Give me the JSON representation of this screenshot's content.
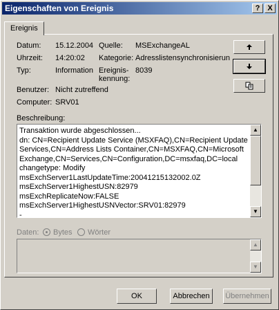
{
  "window": {
    "title": "Eigenschaften von Ereignis",
    "help_btn": "?",
    "close_btn": "X"
  },
  "tab": {
    "label": "Ereignis"
  },
  "fields": {
    "datum_label": "Datum:",
    "datum_value": "15.12.2004",
    "uhrzeit_label": "Uhrzeit:",
    "uhrzeit_value": "14:20:02",
    "typ_label": "Typ:",
    "typ_value": "Information",
    "quelle_label": "Quelle:",
    "quelle_value": "MSExchangeAL",
    "kategorie_label": "Kategorie:",
    "kategorie_value": "Adresslistensynchronisierun",
    "kennung_label_1": "Ereignis-",
    "kennung_label_2": "kennung:",
    "kennung_value": "8039",
    "benutzer_label": "Benutzer:",
    "benutzer_value": "Nicht zutreffend",
    "computer_label": "Computer:",
    "computer_value": "SRV01"
  },
  "side_buttons": {
    "up_icon": "arrow-up",
    "down_icon": "arrow-down",
    "copy_icon": "copy"
  },
  "description": {
    "label": "Beschreibung:",
    "text": "Transaktion wurde abgeschlossen...\ndn: CN=Recipient Update Service (MSXFAQ),CN=Recipient Update Services,CN=Address Lists Container,CN=MSXFAQ,CN=Microsoft Exchange,CN=Services,CN=Configuration,DC=msxfaq,DC=local\nchangetype: Modify\nmsExchServer1LastUpdateTime:20041215132002.0Z\nmsExchServer1HighestUSN:82979\nmsExchReplicateNow:FALSE\nmsExchServer1HighestUSNVector:SRV01:82979\n-"
  },
  "data": {
    "label": "Daten:",
    "bytes": "Bytes",
    "words": "Wörter"
  },
  "buttons": {
    "ok": "OK",
    "cancel": "Abbrechen",
    "apply": "Übernehmen"
  }
}
